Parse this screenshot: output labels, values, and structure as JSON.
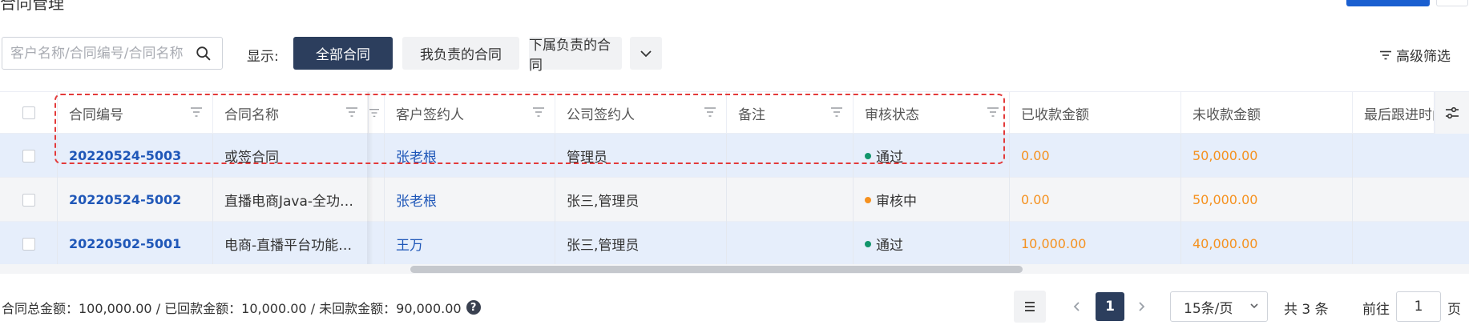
{
  "page_title": "合同管理",
  "search": {
    "placeholder": "客户名称/合同编号/合同名称"
  },
  "filter": {
    "label": "显示:",
    "tabs": [
      {
        "label": "全部合同",
        "active": true
      },
      {
        "label": "我负责的合同",
        "active": false
      },
      {
        "label": "下属负责的合同",
        "active": false
      }
    ],
    "advanced_label": "高级筛选"
  },
  "table": {
    "columns": [
      "合同编号",
      "合同名称",
      "客户签约人",
      "公司签约人",
      "备注",
      "审核状态",
      "已收款金额",
      "未收款金额",
      "最后跟进时间"
    ],
    "rows": [
      {
        "contract_no": "20220524-5003",
        "contract_name": "或签合同",
        "customer_signer": "张老根",
        "company_signer": "管理员",
        "remark": "",
        "status": "通过",
        "received": "0.00",
        "unreceived": "50,000.00",
        "last_follow": ""
      },
      {
        "contract_no": "20220524-5002",
        "contract_name": "直播电商Java-全功…",
        "customer_signer": "张老根",
        "company_signer": "张三,管理员",
        "remark": "",
        "status": "审核中",
        "received": "0.00",
        "unreceived": "50,000.00",
        "last_follow": ""
      },
      {
        "contract_no": "20220502-5001",
        "contract_name": "电商-直播平台功能…",
        "customer_signer": "王万",
        "company_signer": "张三,管理员",
        "remark": "",
        "status": "通过",
        "received": "10,000.00",
        "unreceived": "40,000.00",
        "last_follow": ""
      }
    ]
  },
  "footer": {
    "summary": "合同总金额：100,000.00 / 已回款金额：10,000.00 / 未回款金额：90,000.00",
    "current_page": "1",
    "page_size": "15条/页",
    "total": "共 3 条",
    "goto_label": "前往",
    "goto_value": "1",
    "goto_unit": "页"
  },
  "colors": {
    "primary_dark": "#2c3e5d",
    "link": "#1f57b8",
    "money": "#f5911f",
    "status_pass": "#12956b",
    "status_pending": "#f5911f",
    "highlight": "#e33a3a"
  }
}
